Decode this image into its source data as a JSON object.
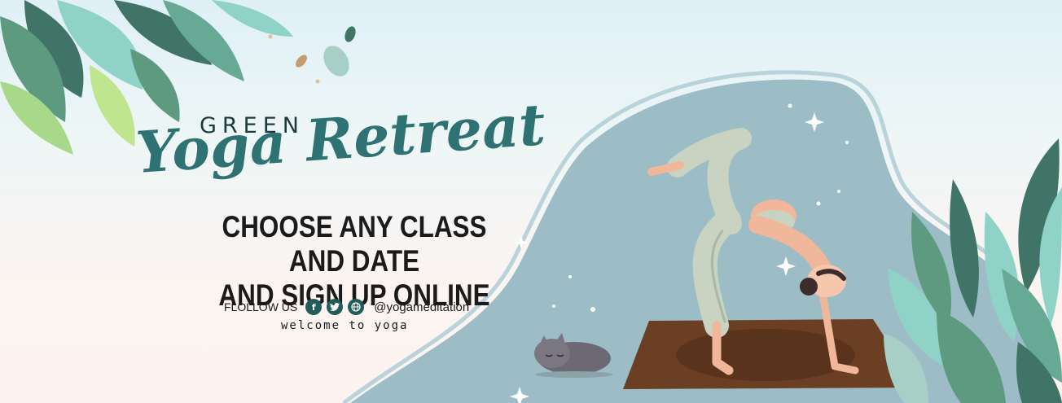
{
  "banner": {
    "eyebrow": "GREEN",
    "script_title": "Yoga Retreat",
    "headline_line1": "CHOOSE ANY CLASS AND DATE",
    "headline_line2": "AND SIGN UP ONLINE",
    "follow_label": "FLOLLOW US",
    "social_icons": [
      "facebook-icon",
      "twitter-icon",
      "globe-icon"
    ],
    "handle": "@yogameditation",
    "tagline": "welcome to yoga"
  },
  "colors": {
    "title_teal": "#2f7273",
    "blob": "#9dbdc6",
    "mat": "#6b3f24",
    "leaf_dark": "#3f7466",
    "leaf_light": "#8fd3c8"
  }
}
